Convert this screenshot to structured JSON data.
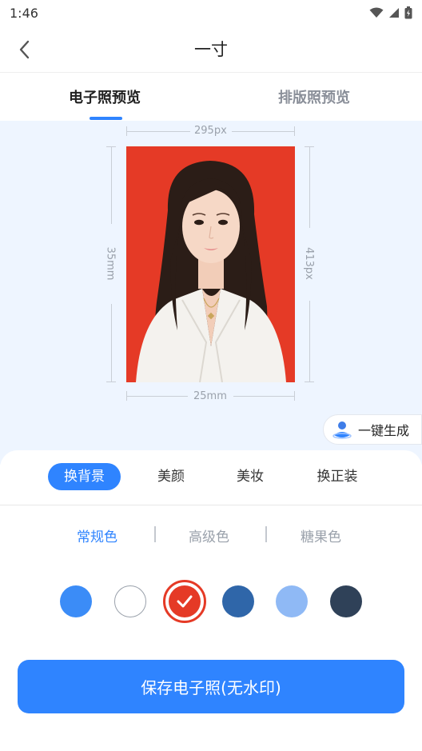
{
  "status_bar": {
    "time": "1:46"
  },
  "nav": {
    "title": "一寸"
  },
  "tabs": [
    {
      "label": "电子照预览",
      "active": true
    },
    {
      "label": "排版照预览",
      "active": false
    }
  ],
  "photo": {
    "width_px_label": "295px",
    "height_px_label": "413px",
    "width_mm_label": "25mm",
    "height_mm_label": "35mm",
    "background_color": "#e53a26"
  },
  "one_click": {
    "label": "一键生成"
  },
  "edit_tabs": [
    {
      "label": "换背景",
      "active": true
    },
    {
      "label": "美颜",
      "active": false
    },
    {
      "label": "美妆",
      "active": false
    },
    {
      "label": "换正装",
      "active": false
    }
  ],
  "color_categories": [
    {
      "label": "常规色",
      "active": true
    },
    {
      "label": "高级色",
      "active": false
    },
    {
      "label": "糖果色",
      "active": false
    }
  ],
  "swatches": [
    {
      "color": "#3b8cf7",
      "selected": false
    },
    {
      "color": "#ffffff",
      "selected": false
    },
    {
      "color": "#e53a26",
      "selected": true
    },
    {
      "color": "#2f66a9",
      "selected": false
    },
    {
      "color": "#8fb9f5",
      "selected": false
    },
    {
      "color": "#2f4158",
      "selected": false
    }
  ],
  "save_button": {
    "label": "保存电子照(无水印)"
  },
  "colors": {
    "accent": "#2f84ff",
    "preview_bg": "#eef5ff"
  }
}
